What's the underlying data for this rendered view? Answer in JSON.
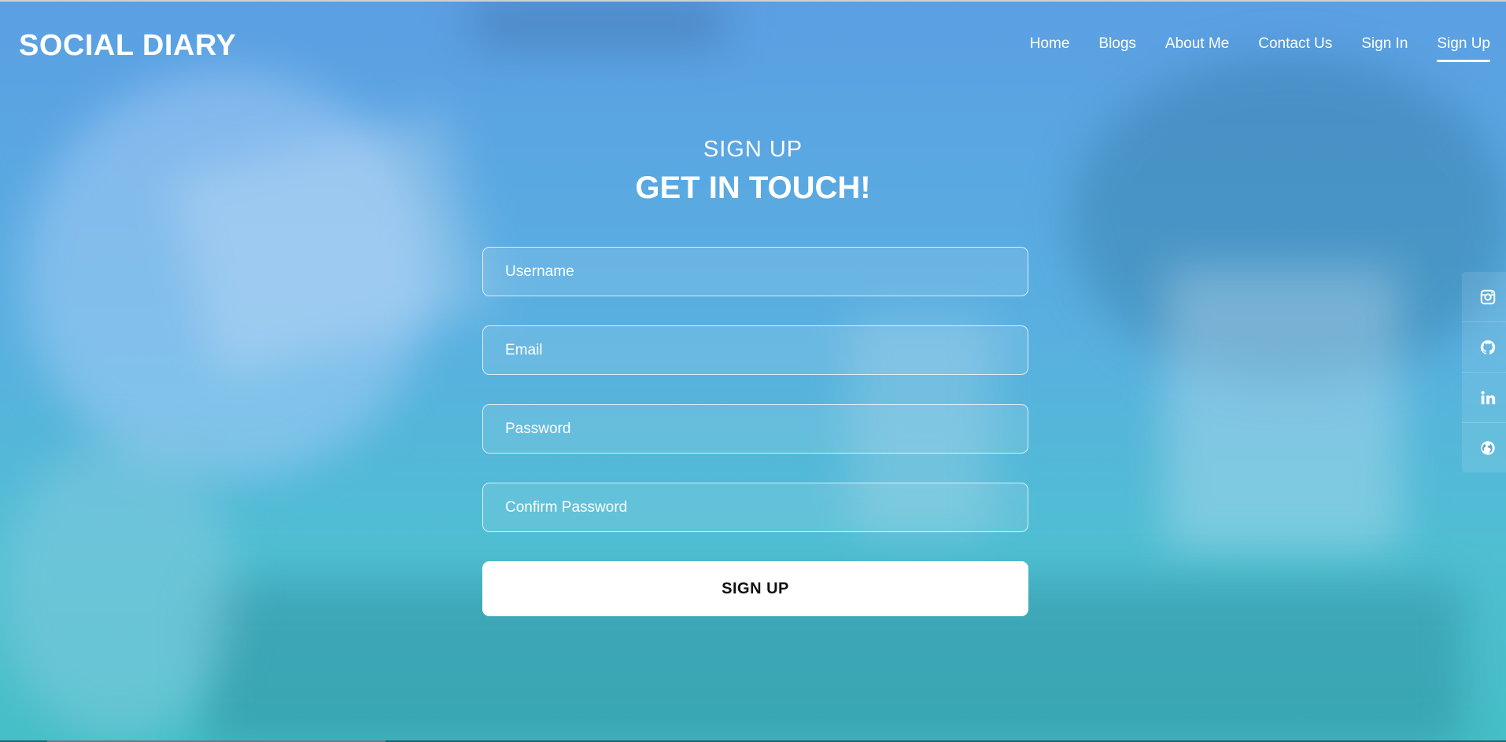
{
  "brand": {
    "name": "SOCIAL DIARY"
  },
  "nav": {
    "items": [
      {
        "label": "Home"
      },
      {
        "label": "Blogs"
      },
      {
        "label": "About Me"
      },
      {
        "label": "Contact Us"
      },
      {
        "label": "Sign In"
      },
      {
        "label": "Sign Up",
        "active": true
      }
    ]
  },
  "section": {
    "label": "SIGN UP",
    "title": "GET IN TOUCH!"
  },
  "form": {
    "username_placeholder": "Username",
    "email_placeholder": "Email",
    "password_placeholder": "Password",
    "confirm_placeholder": "Confirm Password",
    "submit_label": "SIGN UP"
  },
  "social": {
    "icons": [
      "instagram-icon",
      "github-icon",
      "linkedin-icon",
      "globe-icon"
    ]
  },
  "colors": {
    "overlay_top": "#5b9fe3",
    "overlay_bottom": "#46bfc7",
    "text": "#ffffff",
    "button_bg": "#ffffff",
    "button_text": "#111111"
  }
}
